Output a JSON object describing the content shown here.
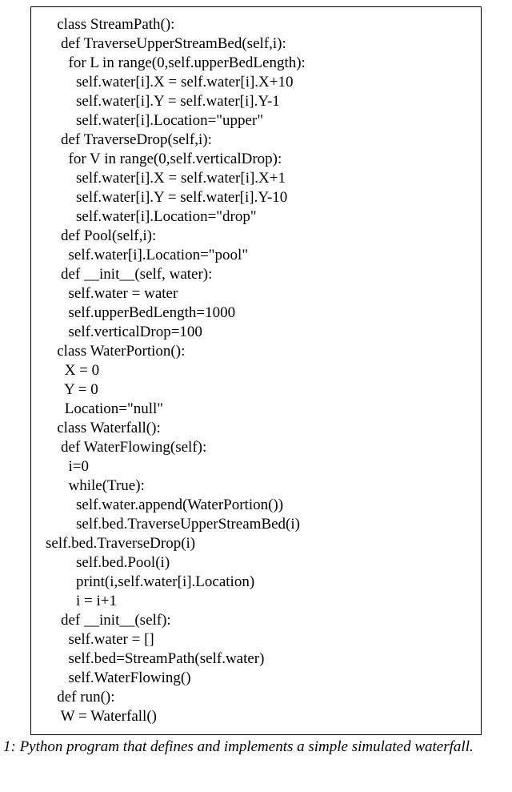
{
  "code": {
    "lines": [
      "   class StreamPath():",
      "    def TraverseUpperStreamBed(self,i):",
      "      for L in range(0,self.upperBedLength):",
      "        self.water[i].X = self.water[i].X+10",
      "        self.water[i].Y = self.water[i].Y-1",
      "        self.water[i].Location=\"upper\"",
      "    def TraverseDrop(self,i):",
      "      for V in range(0,self.verticalDrop):",
      "        self.water[i].X = self.water[i].X+1",
      "        self.water[i].Y = self.water[i].Y-10",
      "        self.water[i].Location=\"drop\"",
      "    def Pool(self,i):",
      "      self.water[i].Location=\"pool\"",
      "    def __init__(self, water):",
      "      self.water = water",
      "      self.upperBedLength=1000",
      "      self.verticalDrop=100",
      "",
      "   class WaterPortion():",
      "     X = 0",
      "     Y = 0",
      "     Location=\"null\"",
      "",
      "   class Waterfall():",
      "    def WaterFlowing(self):",
      "      i=0",
      "      while(True):",
      "        self.water.append(WaterPortion())",
      "        self.bed.TraverseUpperStreamBed(i)",
      "self.bed.TraverseDrop(i)",
      "        self.bed.Pool(i)",
      "        print(i,self.water[i].Location)",
      "        i = i+1",
      "    def __init__(self):",
      "      self.water = []",
      "      self.bed=StreamPath(self.water)",
      "      self.WaterFlowing()",
      "   def run():",
      "    W = Waterfall()"
    ]
  },
  "caption": "1: Python program that defines and implements a simple simulated waterfall."
}
